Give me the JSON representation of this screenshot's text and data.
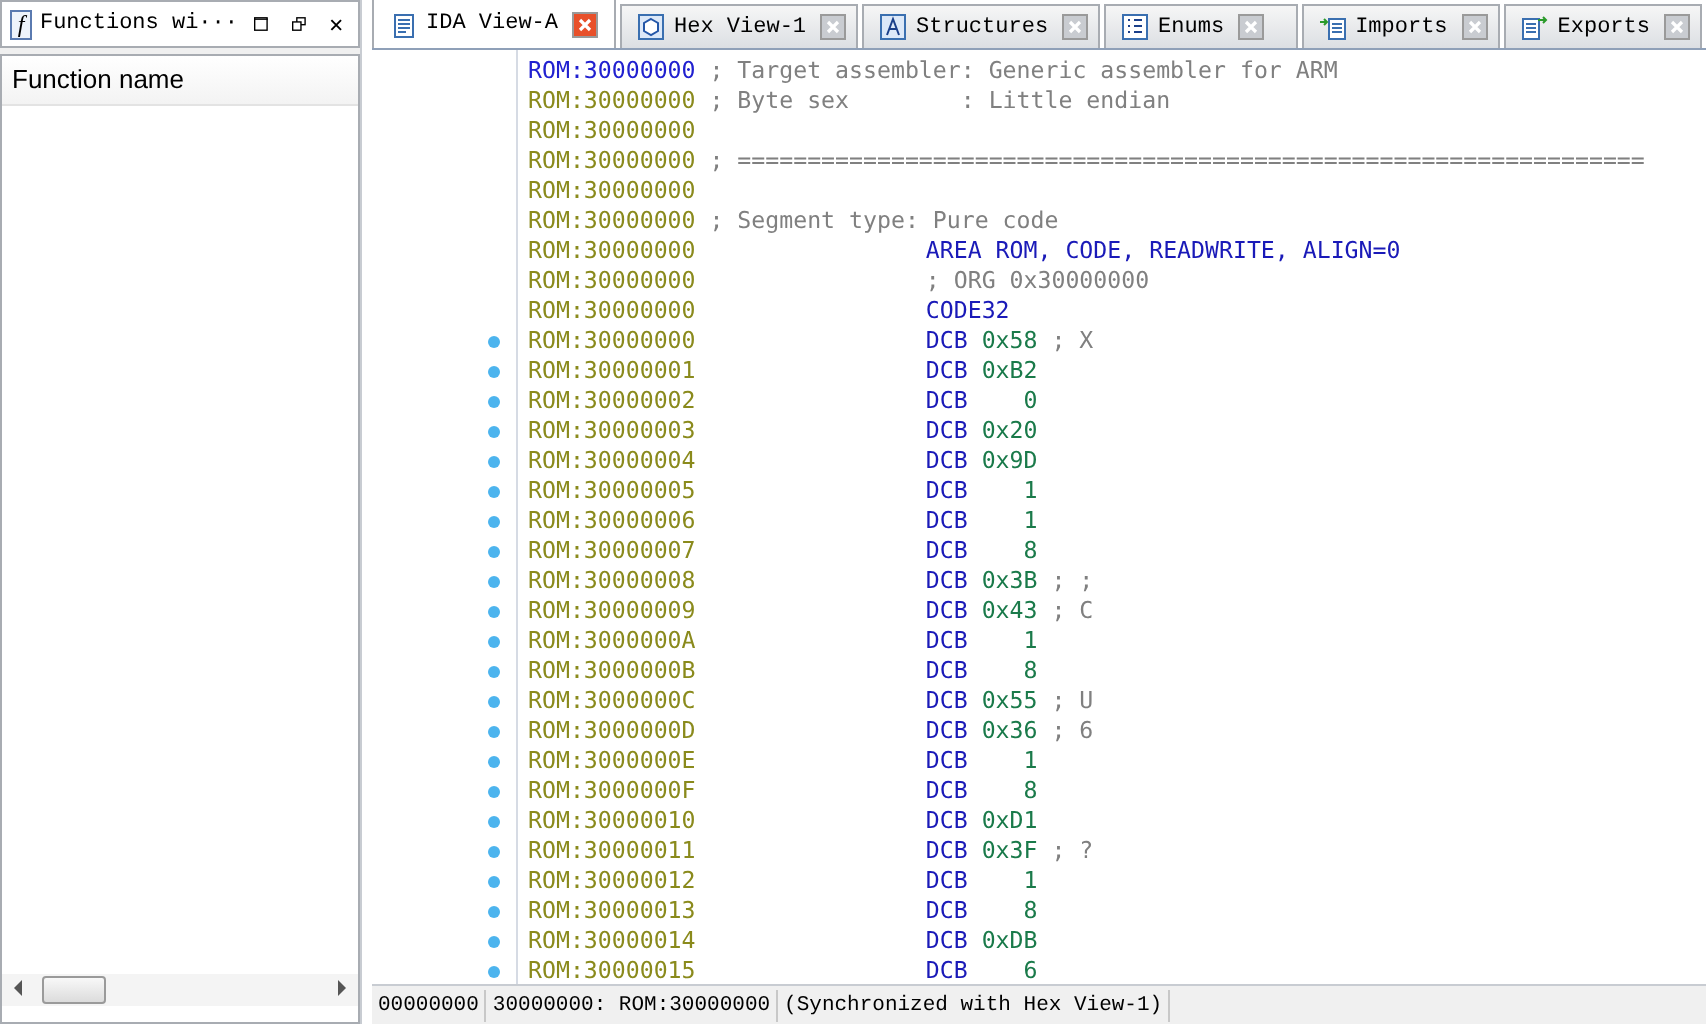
{
  "functions_panel": {
    "icon": "f",
    "title": "Functions wi···",
    "column_header": "Function name"
  },
  "tabs": [
    {
      "label": "IDA View-A",
      "selected": true
    },
    {
      "label": "Hex View-1",
      "selected": false
    },
    {
      "label": "Structures",
      "selected": false
    },
    {
      "label": "Enums",
      "selected": false
    },
    {
      "label": "Imports",
      "selected": false
    },
    {
      "label": "Exports",
      "selected": false
    }
  ],
  "listing": [
    {
      "address": "ROM:30000000",
      "current": true,
      "marker": false,
      "kind": "header",
      "text": "; Target assembler: Generic assembler for ARM"
    },
    {
      "address": "ROM:30000000",
      "current": false,
      "marker": false,
      "kind": "header",
      "text": "; Byte sex        : Little endian"
    },
    {
      "address": "ROM:30000000",
      "current": false,
      "marker": false,
      "kind": "blank"
    },
    {
      "address": "ROM:30000000",
      "current": false,
      "marker": false,
      "kind": "header",
      "text": "; ================================================================="
    },
    {
      "address": "ROM:30000000",
      "current": false,
      "marker": false,
      "kind": "blank"
    },
    {
      "address": "ROM:30000000",
      "current": false,
      "marker": false,
      "kind": "header",
      "text": "; Segment type: Pure code"
    },
    {
      "address": "ROM:30000000",
      "current": false,
      "marker": false,
      "kind": "directive",
      "text": "AREA ROM, CODE, READWRITE, ALIGN=0"
    },
    {
      "address": "ROM:30000000",
      "current": false,
      "marker": false,
      "kind": "note",
      "text": "; ORG 0x30000000"
    },
    {
      "address": "ROM:30000000",
      "current": false,
      "marker": false,
      "kind": "directive",
      "text": "CODE32"
    },
    {
      "address": "ROM:30000000",
      "current": false,
      "marker": true,
      "kind": "data",
      "mnemonic": "DCB",
      "operand": "0x58",
      "comment": "; X"
    },
    {
      "address": "ROM:30000001",
      "current": false,
      "marker": true,
      "kind": "data",
      "mnemonic": "DCB",
      "operand": "0xB2"
    },
    {
      "address": "ROM:30000002",
      "current": false,
      "marker": true,
      "kind": "data",
      "mnemonic": "DCB",
      "operand": "0"
    },
    {
      "address": "ROM:30000003",
      "current": false,
      "marker": true,
      "kind": "data",
      "mnemonic": "DCB",
      "operand": "0x20"
    },
    {
      "address": "ROM:30000004",
      "current": false,
      "marker": true,
      "kind": "data",
      "mnemonic": "DCB",
      "operand": "0x9D"
    },
    {
      "address": "ROM:30000005",
      "current": false,
      "marker": true,
      "kind": "data",
      "mnemonic": "DCB",
      "operand": "1"
    },
    {
      "address": "ROM:30000006",
      "current": false,
      "marker": true,
      "kind": "data",
      "mnemonic": "DCB",
      "operand": "1"
    },
    {
      "address": "ROM:30000007",
      "current": false,
      "marker": true,
      "kind": "data",
      "mnemonic": "DCB",
      "operand": "8"
    },
    {
      "address": "ROM:30000008",
      "current": false,
      "marker": true,
      "kind": "data",
      "mnemonic": "DCB",
      "operand": "0x3B",
      "comment": "; ;"
    },
    {
      "address": "ROM:30000009",
      "current": false,
      "marker": true,
      "kind": "data",
      "mnemonic": "DCB",
      "operand": "0x43",
      "comment": "; C"
    },
    {
      "address": "ROM:3000000A",
      "current": false,
      "marker": true,
      "kind": "data",
      "mnemonic": "DCB",
      "operand": "1"
    },
    {
      "address": "ROM:3000000B",
      "current": false,
      "marker": true,
      "kind": "data",
      "mnemonic": "DCB",
      "operand": "8"
    },
    {
      "address": "ROM:3000000C",
      "current": false,
      "marker": true,
      "kind": "data",
      "mnemonic": "DCB",
      "operand": "0x55",
      "comment": "; U"
    },
    {
      "address": "ROM:3000000D",
      "current": false,
      "marker": true,
      "kind": "data",
      "mnemonic": "DCB",
      "operand": "0x36",
      "comment": "; 6"
    },
    {
      "address": "ROM:3000000E",
      "current": false,
      "marker": true,
      "kind": "data",
      "mnemonic": "DCB",
      "operand": "1"
    },
    {
      "address": "ROM:3000000F",
      "current": false,
      "marker": true,
      "kind": "data",
      "mnemonic": "DCB",
      "operand": "8"
    },
    {
      "address": "ROM:30000010",
      "current": false,
      "marker": true,
      "kind": "data",
      "mnemonic": "DCB",
      "operand": "0xD1"
    },
    {
      "address": "ROM:30000011",
      "current": false,
      "marker": true,
      "kind": "data",
      "mnemonic": "DCB",
      "operand": "0x3F",
      "comment": "; ?"
    },
    {
      "address": "ROM:30000012",
      "current": false,
      "marker": true,
      "kind": "data",
      "mnemonic": "DCB",
      "operand": "1"
    },
    {
      "address": "ROM:30000013",
      "current": false,
      "marker": true,
      "kind": "data",
      "mnemonic": "DCB",
      "operand": "8"
    },
    {
      "address": "ROM:30000014",
      "current": false,
      "marker": true,
      "kind": "data",
      "mnemonic": "DCB",
      "operand": "0xDB"
    },
    {
      "address": "ROM:30000015",
      "current": false,
      "marker": true,
      "kind": "data",
      "mnemonic": "DCB",
      "operand": "6"
    }
  ],
  "status_bar": [
    "00000000",
    "30000000: ROM:30000000",
    "(Synchronized with Hex View-1)"
  ]
}
